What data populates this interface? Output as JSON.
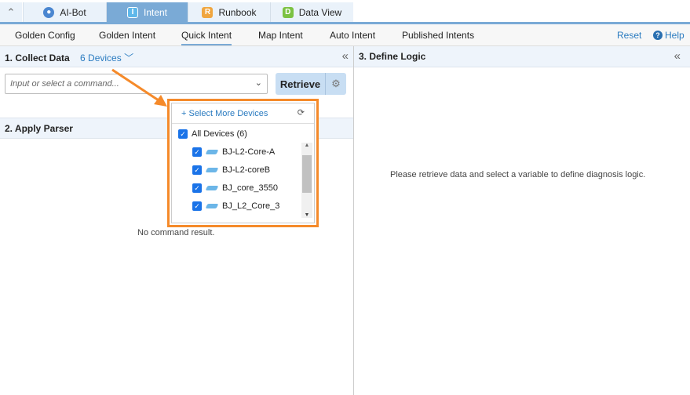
{
  "tabs": [
    {
      "label": "AI-Bot",
      "icon": "robot-icon"
    },
    {
      "label": "Intent",
      "icon": "I",
      "active": true
    },
    {
      "label": "Runbook",
      "icon": "R"
    },
    {
      "label": "Data View",
      "icon": "D"
    }
  ],
  "subnav": {
    "items": [
      "Golden Config",
      "Golden Intent",
      "Quick Intent",
      "Map Intent",
      "Auto Intent",
      "Published Intents"
    ],
    "active": "Quick Intent",
    "reset": "Reset",
    "help": "Help"
  },
  "collect": {
    "title": "1. Collect Data",
    "devices": "6 Devices",
    "placeholder": "Input or select a command...",
    "retrieve": "Retrieve"
  },
  "parser": {
    "title": "2. Apply Parser",
    "empty": "No command result."
  },
  "logic": {
    "title": "3. Define Logic",
    "empty": "Please retrieve data and select a variable to define diagnosis logic."
  },
  "dropdown": {
    "select_more": "+ Select More Devices",
    "all": "All Devices (6)",
    "devices": [
      "BJ-L2-Core-A",
      "BJ-L2-coreB",
      "BJ_core_3550",
      "BJ_L2_Core_3"
    ]
  },
  "colors": {
    "accent": "#7aaad6",
    "highlight": "#f58a2a",
    "link": "#2a7bc0"
  }
}
